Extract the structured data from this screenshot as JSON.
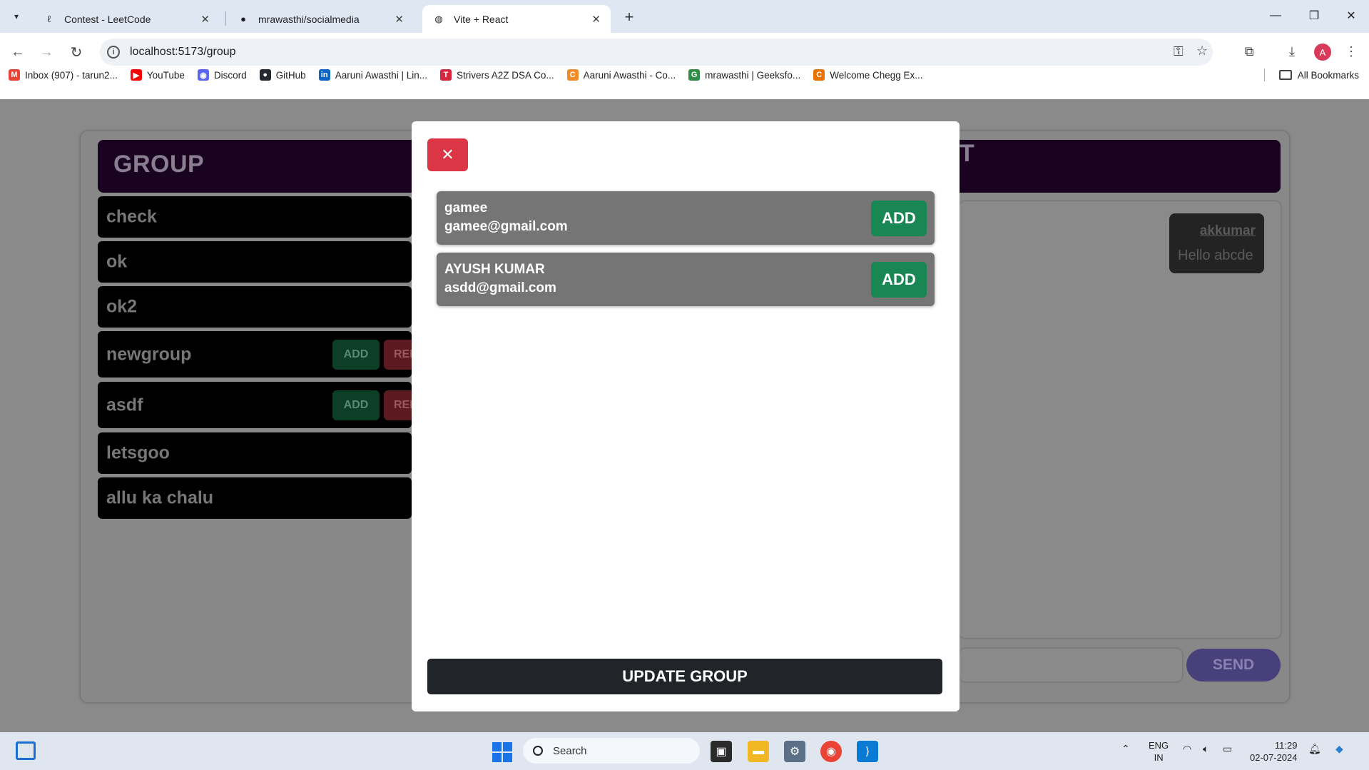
{
  "browser": {
    "tabs": [
      {
        "label": "Contest - LeetCode",
        "icon": "leetcode-icon"
      },
      {
        "label": "mrawasthi/socialmedia",
        "icon": "github-icon"
      },
      {
        "label": "Vite + React",
        "icon": "globe-icon",
        "active": true
      }
    ],
    "url": "localhost:5173/group",
    "bookmarks": [
      {
        "label": "Inbox (907) - tarun2...",
        "icon": "gmail-icon",
        "color": "#ea4335",
        "glyph": "M"
      },
      {
        "label": "YouTube",
        "icon": "youtube-icon",
        "color": "#ff0000",
        "glyph": "▶"
      },
      {
        "label": "Discord",
        "icon": "discord-icon",
        "color": "#5865f2",
        "glyph": "◉"
      },
      {
        "label": "GitHub",
        "icon": "github-icon",
        "color": "#24292f",
        "glyph": "●"
      },
      {
        "label": "Aaruni Awasthi | Lin...",
        "icon": "linkedin-icon",
        "color": "#0a66c2",
        "glyph": "in"
      },
      {
        "label": "Strivers A2Z DSA Co...",
        "icon": "tuf-icon",
        "color": "#d7263d",
        "glyph": "T"
      },
      {
        "label": "Aaruni Awasthi - Co...",
        "icon": "codechef-icon",
        "color": "#f28c28",
        "glyph": "C"
      },
      {
        "label": "mrawasthi | Geeksfo...",
        "icon": "gfg-icon",
        "color": "#2f8d46",
        "glyph": "G"
      },
      {
        "label": "Welcome Chegg Ex...",
        "icon": "chegg-icon",
        "color": "#eb7100",
        "glyph": "C"
      }
    ],
    "all_bookmarks": "All Bookmarks",
    "avatar_initial": "A"
  },
  "app": {
    "group_title": "GROUP",
    "header_right_letter": "T",
    "groups": [
      {
        "name": "check",
        "has_actions": false
      },
      {
        "name": "ok",
        "has_actions": false
      },
      {
        "name": "ok2",
        "has_actions": false
      },
      {
        "name": "newgroup",
        "has_actions": true,
        "add_label": "ADD",
        "remove_label": "REI"
      },
      {
        "name": "asdf",
        "has_actions": true,
        "add_label": "ADD",
        "remove_label": "REI"
      },
      {
        "name": "letsgoo",
        "has_actions": false
      },
      {
        "name": "allu ka chalu",
        "has_actions": false
      }
    ],
    "message": {
      "user": "akkumar",
      "text": "Hello abcde"
    },
    "send_label": "SEND"
  },
  "modal": {
    "close_icon": "close-icon",
    "users": [
      {
        "name": "gamee",
        "email": "gamee@gmail.com",
        "add_label": "ADD"
      },
      {
        "name": "AYUSH KUMAR",
        "email": "asdd@gmail.com",
        "add_label": "ADD"
      }
    ],
    "update_label": "UPDATE GROUP"
  },
  "taskbar": {
    "search_placeholder": "Search",
    "lang_top": "ENG",
    "lang_bottom": "IN",
    "time": "11:29",
    "date": "02-07-2024"
  }
}
